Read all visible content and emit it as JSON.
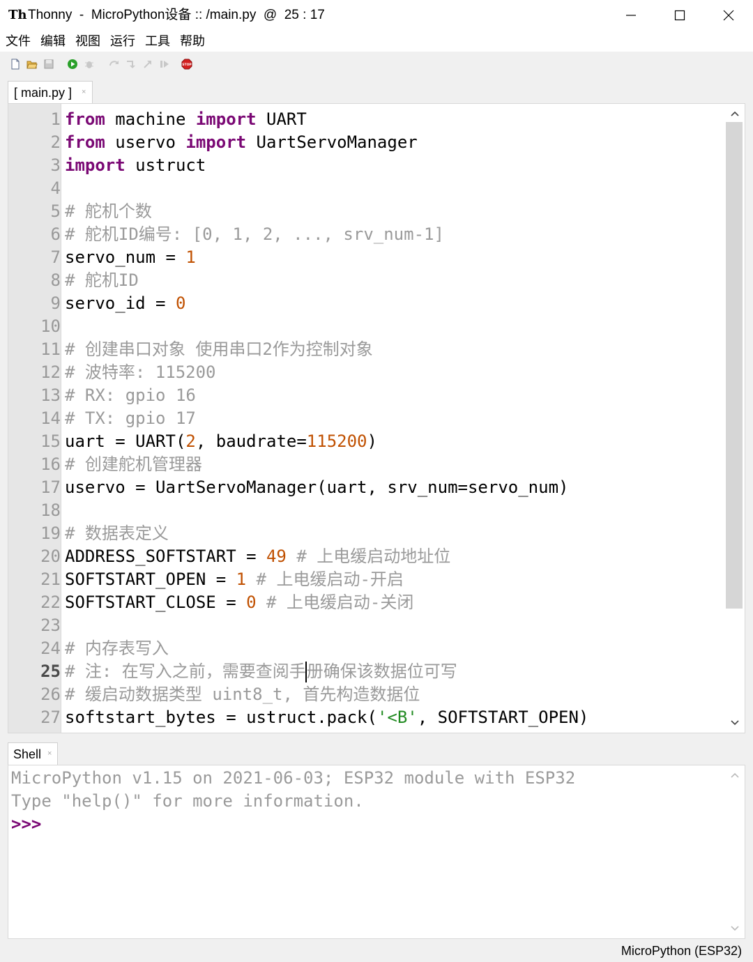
{
  "window": {
    "app_icon": "thonny-icon",
    "title": "Thonny  -  MicroPython设备 :: /main.py  @  25 : 17",
    "controls": [
      "minimize-icon",
      "maximize-icon",
      "close-icon"
    ]
  },
  "menu": [
    "文件",
    "编辑",
    "视图",
    "运行",
    "工具",
    "帮助"
  ],
  "toolbar": {
    "icons": [
      "new-file-icon",
      "open-file-icon",
      "save-icon",
      "run-icon",
      "debug-icon",
      "step-over-icon",
      "step-into-icon",
      "step-out-icon",
      "resume-icon",
      "stop-icon"
    ],
    "stop_label": "STOP"
  },
  "editor": {
    "tab_label": "[ main.py ]",
    "tab_close": "×",
    "current_line": 25,
    "line_numbers": [
      "1",
      "2",
      "3",
      "4",
      "5",
      "6",
      "7",
      "8",
      "9",
      "10",
      "11",
      "12",
      "13",
      "14",
      "15",
      "16",
      "17",
      "18",
      "19",
      "20",
      "21",
      "22",
      "23",
      "24",
      "25",
      "26",
      "27"
    ],
    "lines": [
      [
        {
          "t": "from",
          "c": "kw"
        },
        {
          "t": " machine ",
          "c": ""
        },
        {
          "t": "import",
          "c": "kw"
        },
        {
          "t": " UART",
          "c": ""
        }
      ],
      [
        {
          "t": "from",
          "c": "kw"
        },
        {
          "t": " uservo ",
          "c": ""
        },
        {
          "t": "import",
          "c": "kw"
        },
        {
          "t": " UartServoManager",
          "c": ""
        }
      ],
      [
        {
          "t": "import",
          "c": "kw"
        },
        {
          "t": " ustruct",
          "c": ""
        }
      ],
      [],
      [
        {
          "t": "# 舵机个数",
          "c": "cm"
        }
      ],
      [
        {
          "t": "# 舵机ID编号: [0, 1, 2, ..., srv_num-1]",
          "c": "cm"
        }
      ],
      [
        {
          "t": "servo_num = ",
          "c": ""
        },
        {
          "t": "1",
          "c": "num"
        }
      ],
      [
        {
          "t": "# 舵机ID",
          "c": "cm"
        }
      ],
      [
        {
          "t": "servo_id = ",
          "c": ""
        },
        {
          "t": "0",
          "c": "num"
        }
      ],
      [],
      [
        {
          "t": "# 创建串口对象 使用串口2作为控制对象",
          "c": "cm"
        }
      ],
      [
        {
          "t": "# 波特率: 115200",
          "c": "cm"
        }
      ],
      [
        {
          "t": "# RX: gpio 16",
          "c": "cm"
        }
      ],
      [
        {
          "t": "# TX: gpio 17",
          "c": "cm"
        }
      ],
      [
        {
          "t": "uart = UART(",
          "c": ""
        },
        {
          "t": "2",
          "c": "num"
        },
        {
          "t": ", baudrate=",
          "c": ""
        },
        {
          "t": "115200",
          "c": "num"
        },
        {
          "t": ")",
          "c": ""
        }
      ],
      [
        {
          "t": "# 创建舵机管理器",
          "c": "cm"
        }
      ],
      [
        {
          "t": "uservo = UartServoManager(uart, srv_num=servo_num)",
          "c": ""
        }
      ],
      [],
      [
        {
          "t": "# 数据表定义",
          "c": "cm"
        }
      ],
      [
        {
          "t": "ADDRESS_SOFTSTART = ",
          "c": ""
        },
        {
          "t": "49",
          "c": "num"
        },
        {
          "t": " # 上电缓启动地址位",
          "c": "cm"
        }
      ],
      [
        {
          "t": "SOFTSTART_OPEN = ",
          "c": ""
        },
        {
          "t": "1",
          "c": "num"
        },
        {
          "t": " # 上电缓启动-开启",
          "c": "cm"
        }
      ],
      [
        {
          "t": "SOFTSTART_CLOSE = ",
          "c": ""
        },
        {
          "t": "0",
          "c": "num"
        },
        {
          "t": " # 上电缓启动-关闭",
          "c": "cm"
        }
      ],
      [],
      [
        {
          "t": "# 内存表写入",
          "c": "cm"
        }
      ],
      [
        {
          "t": "# 注: 在写入之前，需要查阅手",
          "c": "cm"
        },
        {
          "t": "",
          "c": "cursor"
        },
        {
          "t": "册确保该数据位可写",
          "c": "cm"
        }
      ],
      [
        {
          "t": "# 缓启动数据类型 uint8_t, 首先构造数据位",
          "c": "cm"
        }
      ],
      [
        {
          "t": "softstart_bytes = ustruct.pack(",
          "c": ""
        },
        {
          "t": "'<B'",
          "c": "str"
        },
        {
          "t": ", SOFTSTART_OPEN)",
          "c": ""
        }
      ]
    ]
  },
  "shell": {
    "tab_label": "Shell",
    "tab_close": "×",
    "banner_line1": "MicroPython v1.15 on 2021-06-03; ESP32 module with ESP32",
    "banner_line2": "Type \"help()\" for more information.",
    "prompt": ">>>"
  },
  "status": {
    "interpreter": "MicroPython (ESP32)"
  }
}
